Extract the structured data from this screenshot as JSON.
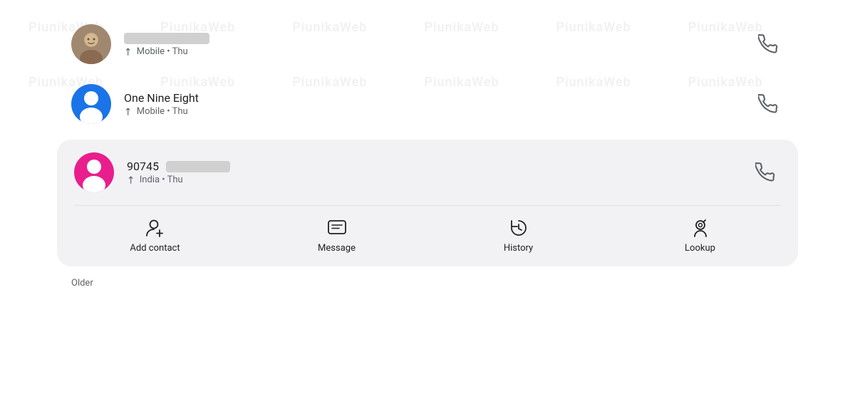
{
  "watermark": {
    "texts": [
      "PiunikaWeb",
      "PiunikaWeb",
      "PiunikaWeb",
      "PiunikaWeb",
      "PiunikaWeb",
      "PiunikaWeb",
      "PiunikaWeb",
      "PiunikaWeb",
      "PiunikaWeb",
      "PiunikaWeb",
      "PiunikaWeb",
      "PiunikaWeb"
    ]
  },
  "calls": [
    {
      "id": "call-1",
      "name": "",
      "name_blurred": true,
      "type": "photo",
      "meta": "Mobile • Thu",
      "call_type": "outgoing"
    },
    {
      "id": "call-2",
      "name": "One Nine Eight",
      "name_blurred": false,
      "type": "blue",
      "meta": "Mobile • Thu",
      "call_type": "outgoing"
    },
    {
      "id": "call-3",
      "name": "90745",
      "name_blurred": true,
      "type": "pink",
      "meta": "India • Thu",
      "call_type": "outgoing",
      "expanded": true
    }
  ],
  "actions": [
    {
      "id": "add-contact",
      "label": "Add contact",
      "icon": "add_contact"
    },
    {
      "id": "message",
      "label": "Message",
      "icon": "message"
    },
    {
      "id": "history",
      "label": "History",
      "icon": "history"
    },
    {
      "id": "lookup",
      "label": "Lookup",
      "icon": "lookup"
    }
  ],
  "older_label": "Older",
  "phone_icon": "📞",
  "outgoing_symbol": "↗"
}
